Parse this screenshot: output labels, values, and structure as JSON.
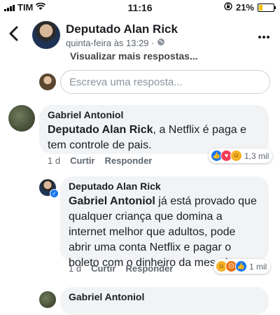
{
  "status_bar": {
    "carrier": "TIM",
    "time": "11:16",
    "battery_percent": "21%",
    "battery_level": 0.21
  },
  "header": {
    "title": "Deputado Alan Rick",
    "subtitle": "quinta-feira às 13:29 ·"
  },
  "view_more": "Visualizar mais respostas...",
  "reply_box": {
    "placeholder": "Escreva uma resposta..."
  },
  "comments": [
    {
      "author": "Gabriel Antoniol",
      "mention": "Deputado Alan Rick",
      "text": ", a Netflix é paga e tem controle de pais.",
      "time": "1 d",
      "like_label": "Curtir",
      "reply_label": "Responder",
      "reactions": [
        "like-icon",
        "love-icon",
        "haha-icon"
      ],
      "reaction_count": "1,3 mil"
    },
    {
      "author": "Deputado Alan Rick",
      "mention": "Gabriel Antoniol",
      "text": " já está provado que qualquer criança que domina a internet melhor que adultos, pode abrir uma conta Netflix e pagar o boleto com o dinheiro da mesada.",
      "time": "1 d",
      "like_label": "Curtir",
      "reply_label": "Responder",
      "reactions": [
        "haha-icon",
        "angry-icon",
        "like-icon"
      ],
      "reaction_count": "1 mil"
    },
    {
      "author": "Gabriel Antoniol"
    }
  ],
  "colors": {
    "accent": "#1877f2",
    "bubble": "#f2f3f5",
    "muted": "#606770"
  }
}
